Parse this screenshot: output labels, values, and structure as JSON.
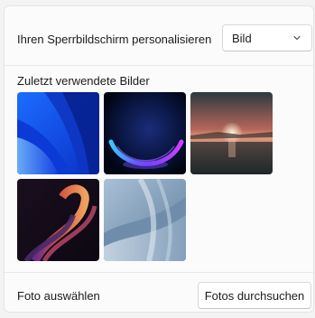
{
  "lockscreen": {
    "personalize_label": "Ihren Sperrbildschirm personalisieren",
    "dropdown_value": "Bild",
    "dropdown_icon": "chevron-down-icon"
  },
  "recent": {
    "label": "Zuletzt verwendete Bilder",
    "images": [
      "bloom-blue-wallpaper",
      "glow-orb-wallpaper",
      "sunset-lake-wallpaper",
      "ribbon-swirl-wallpaper",
      "bloom-light-wallpaper"
    ]
  },
  "choose_photo": {
    "label": "Foto auswählen",
    "browse_label": "Fotos durchsuchen"
  }
}
